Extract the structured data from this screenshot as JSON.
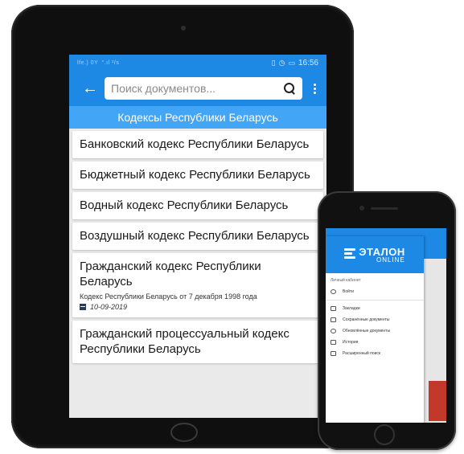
{
  "tablet": {
    "status_left": "lfe.) 0Y  °.ıl  ²/s",
    "status_time": "16:56",
    "search_placeholder": "Поиск документов...",
    "subtitle": "Кодексы Республики Беларусь",
    "items": [
      {
        "title": "Банковский кодекс Республики Беларусь"
      },
      {
        "title": "Бюджетный кодекс Республики Беларусь"
      },
      {
        "title": "Водный кодекс Республики Беларусь"
      },
      {
        "title": "Воздушный кодекс Республики Беларусь"
      },
      {
        "title": "Гражданский кодекс Республики Беларусь",
        "description": "Кодекс Республики Беларусь от 7 декабря 1998 года",
        "date": "10-09-2019"
      },
      {
        "title": "Гражданский процессуальный кодекс Республики Беларусь"
      }
    ]
  },
  "phone": {
    "logo_big": "ЭТАЛОН",
    "logo_small": "ONLINE",
    "section_label": "Личный кабинет",
    "menu_primary": [
      "Войти"
    ],
    "menu_secondary": [
      "Закладки",
      "Сохранённые документы",
      "Обновлённые документы",
      "История",
      "Расширенный поиск"
    ]
  },
  "colors": {
    "app_blue": "#1e88e5",
    "subtitle_blue": "#42a5f5",
    "list_bg": "#eaeaea"
  }
}
